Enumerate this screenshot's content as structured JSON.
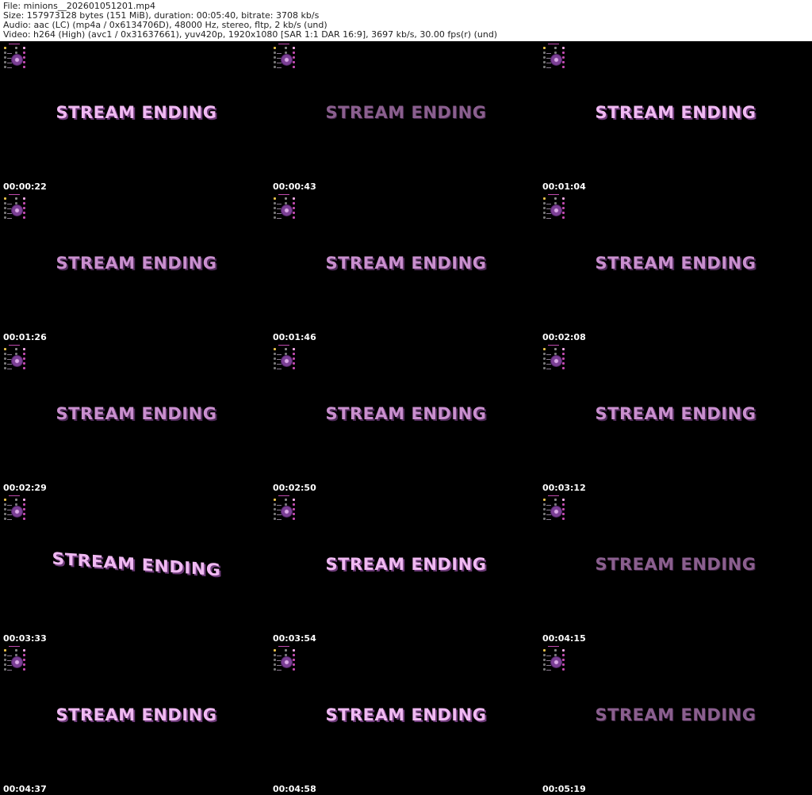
{
  "header": {
    "file_line": "File: minions__202601051201.mp4",
    "size_line": "Size: 157973128 bytes (151 MiB), duration: 00:05:40, bitrate: 3708 kb/s",
    "audio_line": "Audio: aac (LC) (mp4a / 0x6134706D), 48000 Hz, stereo, fltp, 2 kb/s (und)",
    "video_line": "Video: h264 (High) (avc1 / 0x31637661), yuv420p, 1920x1080 [SAR 1:1 DAR 16:9], 3697 kb/s, 30.00 fps(r) (und)"
  },
  "colors": {
    "title_bright": "#f0b9f2",
    "title_dim": "#8a5f8e",
    "background": "#000000"
  },
  "thumbnails": [
    {
      "title": "STREAM ENDING",
      "timestamp": "00:00:22",
      "style": "bright"
    },
    {
      "title": "STREAM ENDING",
      "timestamp": "00:00:43",
      "style": "dim"
    },
    {
      "title": "STREAM ENDING",
      "timestamp": "00:01:04",
      "style": "bright"
    },
    {
      "title": "STREAM ENDING",
      "timestamp": "00:01:26",
      "style": "mid"
    },
    {
      "title": "STREAM ENDING",
      "timestamp": "00:01:46",
      "style": "mid"
    },
    {
      "title": "STREAM ENDING",
      "timestamp": "00:02:08",
      "style": "mid"
    },
    {
      "title": "STREAM ENDING",
      "timestamp": "00:02:29",
      "style": "mid"
    },
    {
      "title": "STREAM ENDING",
      "timestamp": "00:02:50",
      "style": "mid"
    },
    {
      "title": "STREAM ENDING",
      "timestamp": "00:03:12",
      "style": "mid"
    },
    {
      "title": "STREAM ENDING",
      "timestamp": "00:03:33",
      "style": "skew"
    },
    {
      "title": "STREAM ENDING",
      "timestamp": "00:03:54",
      "style": "bright"
    },
    {
      "title": "STREAM ENDING",
      "timestamp": "00:04:15",
      "style": "dim"
    },
    {
      "title": "STREAM ENDING",
      "timestamp": "00:04:37",
      "style": "bright"
    },
    {
      "title": "STREAM ENDING",
      "timestamp": "00:04:58",
      "style": "bright"
    },
    {
      "title": "STREAM ENDING",
      "timestamp": "00:05:19",
      "style": "dim"
    }
  ]
}
